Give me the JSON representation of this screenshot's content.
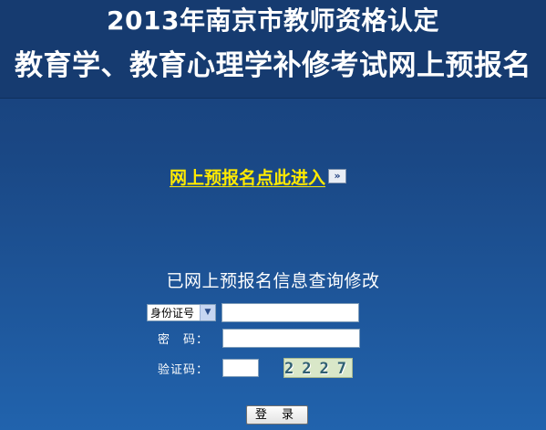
{
  "header": {
    "title_line1": "2013年南京市教师资格认定",
    "title_line2": "教育学、教育心理学补修考试网上预报名"
  },
  "entry_link": {
    "label": "网上预报名点此进入",
    "icon": "double-arrow-icon"
  },
  "query": {
    "title": "已网上预报名信息查询修改",
    "id_type_selected": "身份证号",
    "id_value": "",
    "password_label": "密　码：",
    "password_value": "",
    "captcha_label": "验证码：",
    "captcha_value": "",
    "captcha_image_text": "2227",
    "login_button": "登 录"
  },
  "colors": {
    "header_bg": "#163b70",
    "page_bg_top": "#173f78",
    "page_bg_bottom": "#2163ad",
    "link_color": "#ffea00"
  }
}
